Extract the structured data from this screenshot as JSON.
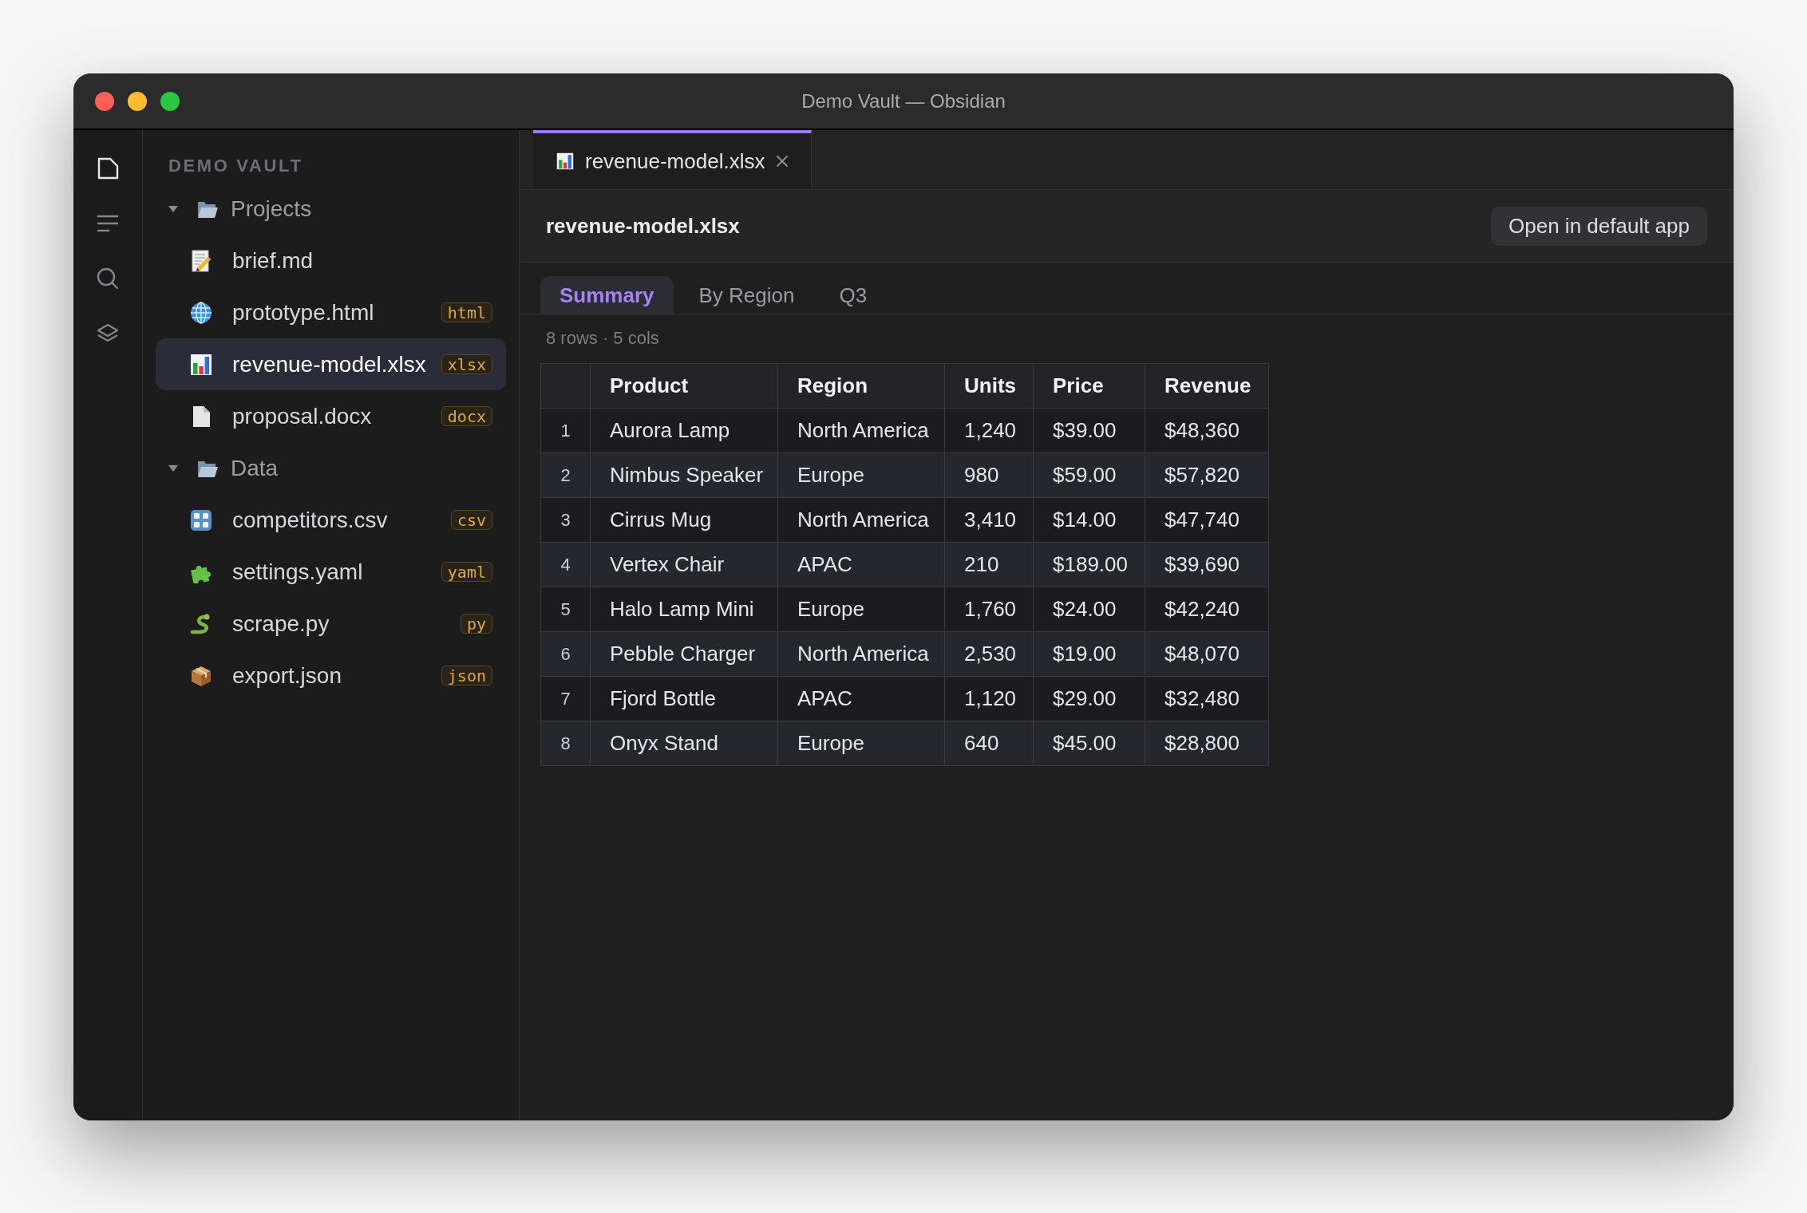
{
  "window": {
    "title": "Demo Vault — Obsidian"
  },
  "ribbon": [
    {
      "selected": true
    },
    {
      "selected": false
    },
    {
      "selected": false
    },
    {
      "selected": false
    }
  ],
  "sidebar": {
    "title": "DEMO VAULT",
    "tree": [
      {
        "label": "Projects",
        "expanded": true,
        "selected": false,
        "children": [
          {
            "label": "brief.md",
            "kind": "note",
            "selected": false
          },
          {
            "label": "prototype.html",
            "kind": "web",
            "badge": "html",
            "selected": false
          },
          {
            "label": "revenue-model.xlsx",
            "kind": "sheet",
            "badge": "xlsx",
            "selected": true
          },
          {
            "label": "proposal.docx",
            "kind": "doc",
            "badge": "docx",
            "selected": false
          }
        ]
      },
      {
        "label": "Data",
        "expanded": true,
        "selected": false,
        "children": [
          {
            "label": "competitors.csv",
            "kind": "table",
            "badge": "csv",
            "selected": false
          },
          {
            "label": "settings.yaml",
            "kind": "plugin",
            "badge": "yaml",
            "selected": false
          },
          {
            "label": "scrape.py",
            "kind": "script",
            "badge": "py",
            "selected": false
          },
          {
            "label": "export.json",
            "kind": "package",
            "badge": "json",
            "selected": false
          }
        ]
      }
    ]
  },
  "editor": {
    "tabs": [
      {
        "label": "revenue-model.xlsx",
        "kind": "sheet",
        "selected": true
      }
    ],
    "title": "revenue-model.xlsx",
    "button": "Open in default app",
    "sheets": [
      {
        "label": "Summary",
        "selected": true
      },
      {
        "label": "By Region",
        "selected": false
      },
      {
        "label": "Q3",
        "selected": false
      }
    ],
    "summary": "8 rows · 5 cols",
    "table": {
      "columns": [
        "Product",
        "Region",
        "Units",
        "Price",
        "Revenue"
      ],
      "rows": [
        {
          "number": "1",
          "cells": [
            "Aurora Lamp",
            "North America",
            "1,240",
            "$39.00",
            "$48,360"
          ]
        },
        {
          "number": "2",
          "cells": [
            "Nimbus Speaker",
            "Europe",
            "980",
            "$59.00",
            "$57,820"
          ]
        },
        {
          "number": "3",
          "cells": [
            "Cirrus Mug",
            "North America",
            "3,410",
            "$14.00",
            "$47,740"
          ]
        },
        {
          "number": "4",
          "cells": [
            "Vertex Chair",
            "APAC",
            "210",
            "$189.00",
            "$39,690"
          ]
        },
        {
          "number": "5",
          "cells": [
            "Halo Lamp Mini",
            "Europe",
            "1,760",
            "$24.00",
            "$42,240"
          ]
        },
        {
          "number": "6",
          "cells": [
            "Pebble Charger",
            "North America",
            "2,530",
            "$19.00",
            "$48,070"
          ]
        },
        {
          "number": "7",
          "cells": [
            "Fjord Bottle",
            "APAC",
            "1,120",
            "$29.00",
            "$32,480"
          ]
        },
        {
          "number": "8",
          "cells": [
            "Onyx Stand",
            "Europe",
            "640",
            "$45.00",
            "$28,800"
          ]
        }
      ]
    }
  }
}
